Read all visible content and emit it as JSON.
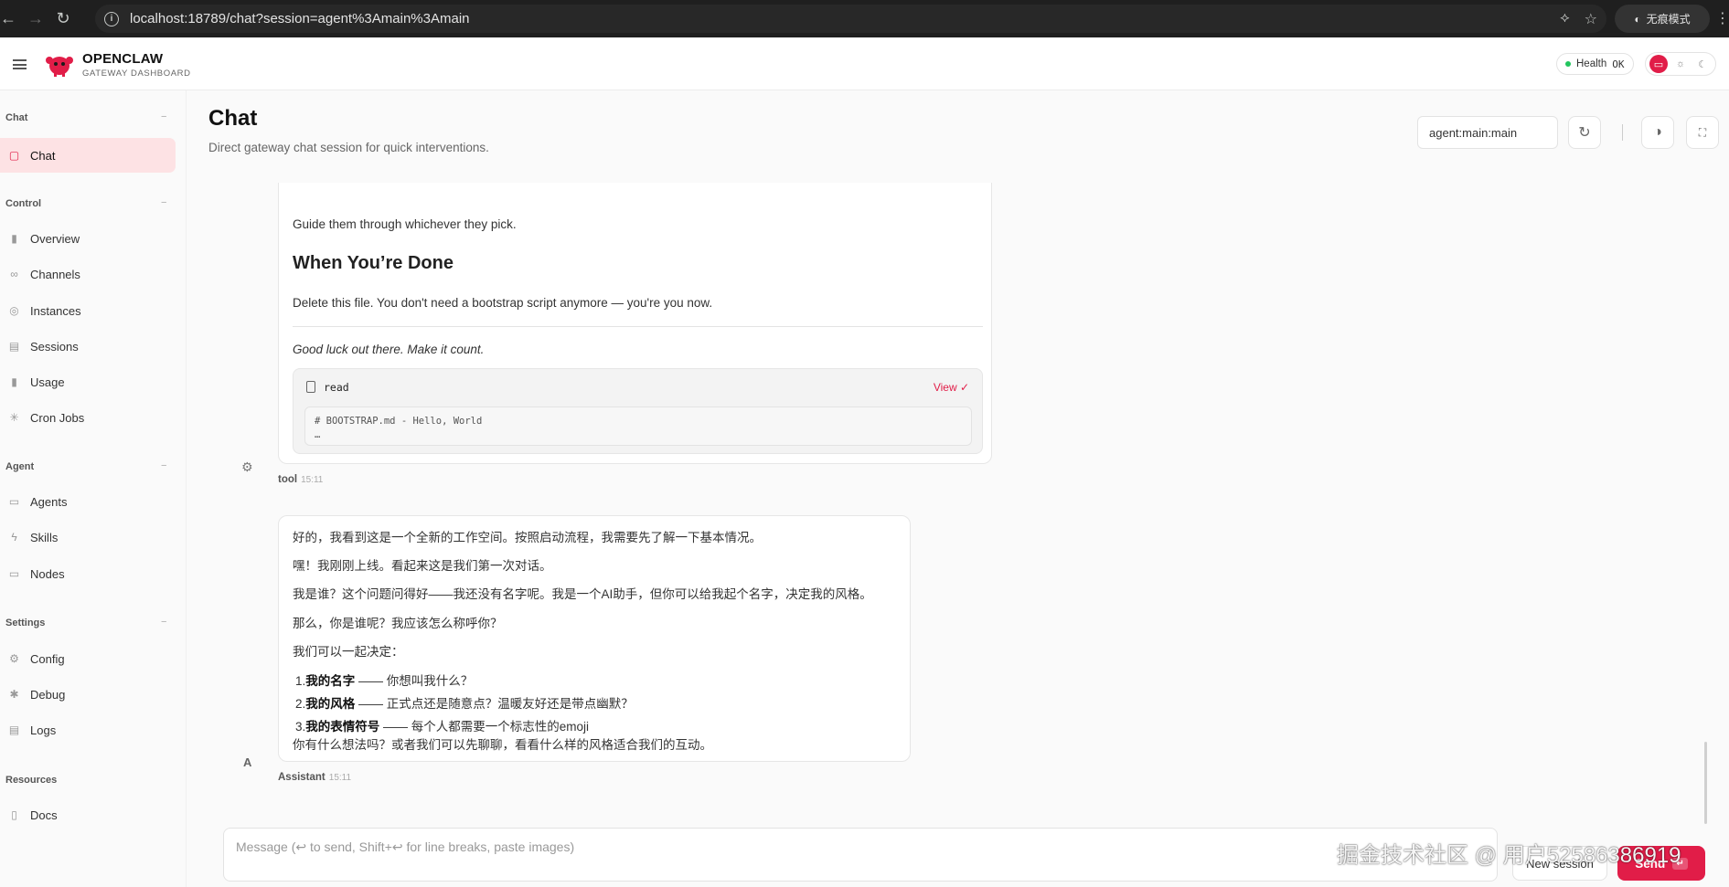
{
  "browser": {
    "url": "localhost:18789/chat?session=agent%3Amain%3Amain",
    "incognito_label": "无痕模式"
  },
  "header": {
    "brand": "OPENCLAW",
    "brand_sub": "GATEWAY DASHBOARD",
    "health_label": "Health",
    "health_value": "OK",
    "health_color": "#22c55e",
    "accent": "#e11d48"
  },
  "sidebar": {
    "sections": [
      {
        "label": "Chat",
        "items": [
          {
            "label": "Chat",
            "icon": "message-icon",
            "active": true
          }
        ]
      },
      {
        "label": "Control",
        "items": [
          {
            "label": "Overview",
            "icon": "bar-chart-icon"
          },
          {
            "label": "Channels",
            "icon": "link-icon"
          },
          {
            "label": "Instances",
            "icon": "radio-icon"
          },
          {
            "label": "Sessions",
            "icon": "document-icon"
          },
          {
            "label": "Usage",
            "icon": "bar-chart-icon"
          },
          {
            "label": "Cron Jobs",
            "icon": "loader-icon"
          }
        ]
      },
      {
        "label": "Agent",
        "items": [
          {
            "label": "Agents",
            "icon": "folder-icon"
          },
          {
            "label": "Skills",
            "icon": "zap-icon"
          },
          {
            "label": "Nodes",
            "icon": "monitor-icon"
          }
        ]
      },
      {
        "label": "Settings",
        "items": [
          {
            "label": "Config",
            "icon": "gear-icon"
          },
          {
            "label": "Debug",
            "icon": "bug-icon"
          },
          {
            "label": "Logs",
            "icon": "file-text-icon"
          }
        ]
      },
      {
        "label": "Resources",
        "items": [
          {
            "label": "Docs",
            "icon": "book-icon"
          }
        ]
      }
    ]
  },
  "main": {
    "title": "Chat",
    "subtitle": "Direct gateway chat session for quick interventions.",
    "session_key": "agent:main:main"
  },
  "tool_message": {
    "line1": "Guide them through whichever they pick.",
    "heading": "When You’re Done",
    "line2": "Delete this file. You don't need a bootstrap script anymore — you're you now.",
    "line3": "Good luck out there. Make it count.",
    "read_name": "read",
    "view_label": "View ✓",
    "code_line1": "# BOOTSTRAP.md - Hello, World",
    "code_line2": "…",
    "sender": "tool",
    "time": "15:11"
  },
  "assistant_message": {
    "p1": "好的，我看到这是一个全新的工作空间。按照启动流程，我需要先了解一下基本情况。",
    "p2": "嘿！我刚刚上线。看起来这是我们第一次对话。",
    "p3": "我是谁？这个问题问得好——我还没有名字呢。我是一个AI助手，但你可以给我起个名字，决定我的风格。",
    "p4": "那么，你是谁呢？我应该怎么称呼你？",
    "p5": "我们可以一起决定：",
    "items": [
      {
        "num": "1.",
        "bold": "我的名字",
        "rest": " —— 你想叫我什么？"
      },
      {
        "num": "2.",
        "bold": "我的风格",
        "rest": " —— 正式点还是随意点？温暖友好还是带点幽默？"
      },
      {
        "num": "3.",
        "bold": "我的表情符号",
        "rest": " —— 每个人都需要一个标志性的emoji"
      }
    ],
    "p6": "你有什么想法吗？或者我们可以先聊聊，看看什么样的风格适合我们的互动。",
    "avatar": "A",
    "sender": "Assistant",
    "time": "15:11"
  },
  "composer": {
    "placeholder": "Message (↩ to send, Shift+↩ for line breaks, paste images)",
    "new_session_label": "New session",
    "send_label": "Send",
    "send_key": "↵"
  },
  "watermark": "掘金技术社区 @ 用户52586386919"
}
